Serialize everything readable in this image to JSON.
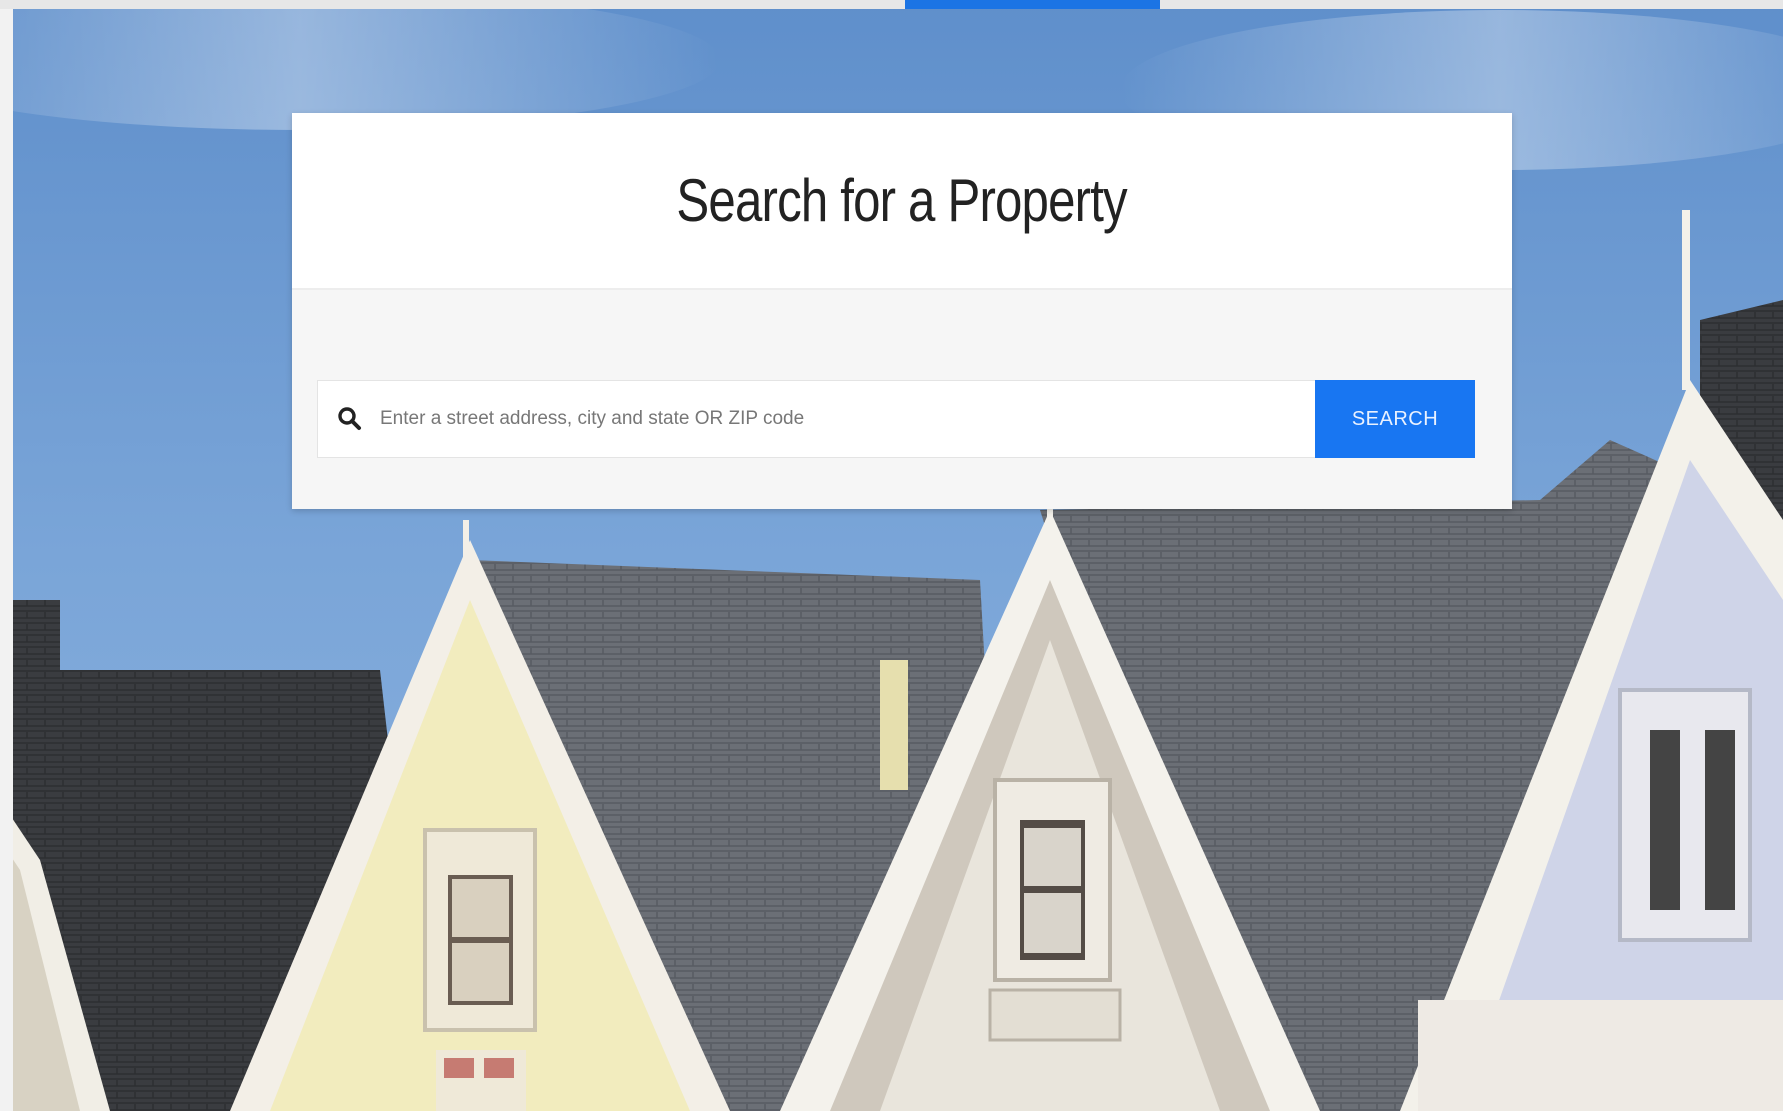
{
  "hero": {
    "description_icon": "house-rooftops-photo"
  },
  "search_card": {
    "title": "Search for a Property",
    "search_placeholder": "Enter a street address, city and state OR ZIP code",
    "search_value": "",
    "search_button_label": "SEARCH",
    "search_icon": "search-icon"
  },
  "colors": {
    "accent": "#1876f2",
    "sky": "#6f9bd0",
    "card": "#ffffff"
  }
}
